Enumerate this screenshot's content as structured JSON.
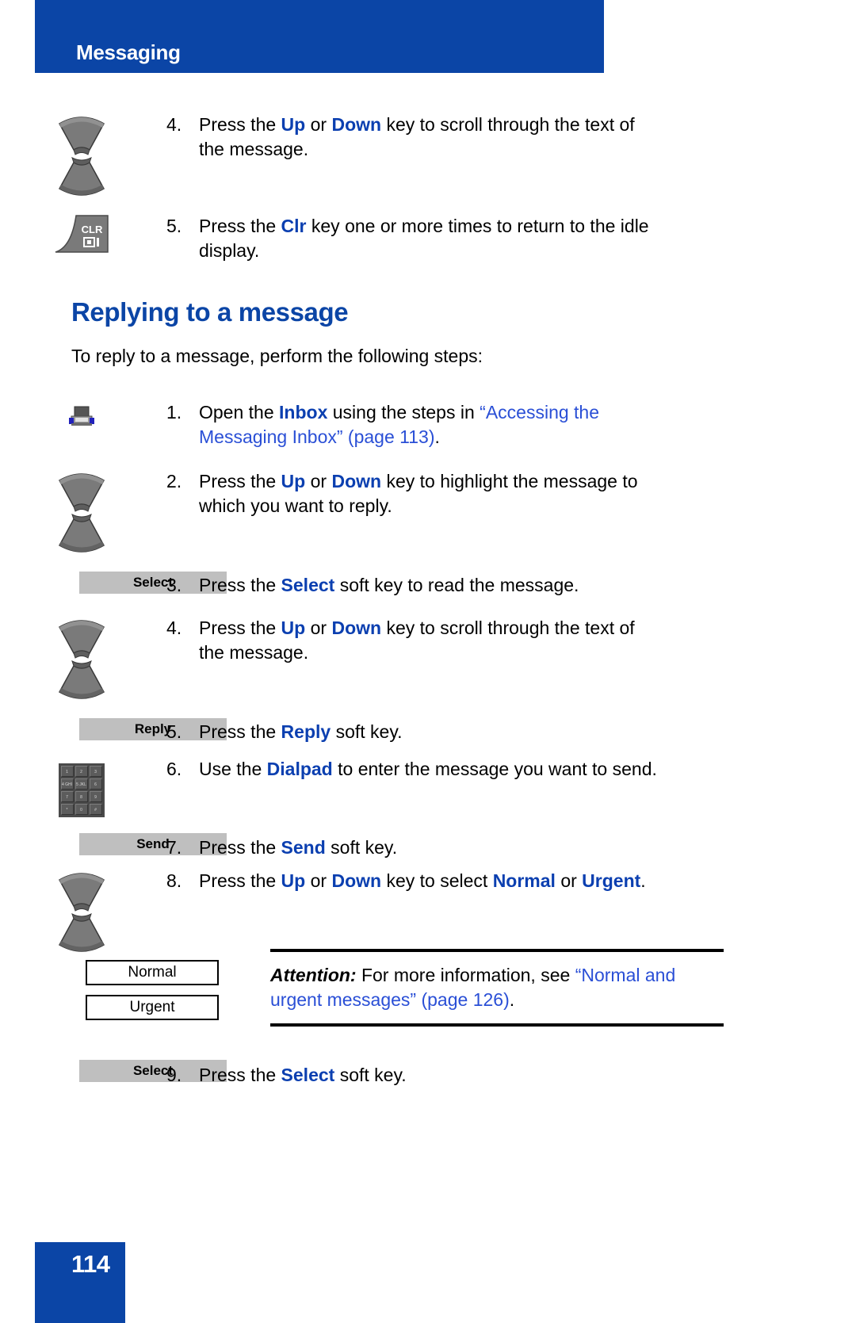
{
  "header": {
    "title": "Messaging",
    "bar_color": "#0b45a6"
  },
  "footer": {
    "page_number": "114",
    "box_color": "#0b45a6"
  },
  "colors": {
    "heading_blue": "#0b45a6",
    "bold_term_blue": "#0b3fb0",
    "link_blue": "#2a4fd6",
    "softkey_gray": "#bfbfbf",
    "key_gray": "#767676"
  },
  "top_steps": [
    {
      "number": "4.",
      "icon": "nav-up-down-key",
      "text_parts": [
        {
          "t": "Press the ",
          "style": "plain"
        },
        {
          "t": "Up",
          "style": "bold"
        },
        {
          "t": " or ",
          "style": "plain"
        },
        {
          "t": "Down",
          "style": "bold"
        },
        {
          "t": " key to scroll through the text of the message.",
          "style": "plain"
        }
      ]
    },
    {
      "number": "5.",
      "icon": "clr-key",
      "text_parts": [
        {
          "t": "Press the ",
          "style": "plain"
        },
        {
          "t": "Clr",
          "style": "bold"
        },
        {
          "t": " key one or more times to return to the idle display.",
          "style": "plain"
        }
      ]
    }
  ],
  "section": {
    "heading": "Replying to a message",
    "intro": "To reply to a message, perform the following steps:"
  },
  "steps": [
    {
      "number": "1.",
      "icon": "inbox-icon",
      "text_parts": [
        {
          "t": "Open the ",
          "style": "plain"
        },
        {
          "t": "Inbox",
          "style": "bold"
        },
        {
          "t": " using the steps in ",
          "style": "plain"
        },
        {
          "t": "“Accessing the Messaging Inbox” (page 113)",
          "style": "link"
        },
        {
          "t": ".",
          "style": "plain"
        }
      ]
    },
    {
      "number": "2.",
      "icon": "nav-up-down-key",
      "text_parts": [
        {
          "t": "Press the ",
          "style": "plain"
        },
        {
          "t": "Up",
          "style": "bold"
        },
        {
          "t": " or ",
          "style": "plain"
        },
        {
          "t": "Down",
          "style": "bold"
        },
        {
          "t": " key to highlight the message to which you want to reply.",
          "style": "plain"
        }
      ]
    },
    {
      "number": "3.",
      "icon": "softkey-select",
      "softkey_label": "Select",
      "text_parts": [
        {
          "t": "Press the ",
          "style": "plain"
        },
        {
          "t": "Select",
          "style": "bold"
        },
        {
          "t": " soft key to read the message.",
          "style": "plain"
        }
      ]
    },
    {
      "number": "4.",
      "icon": "nav-up-down-key",
      "text_parts": [
        {
          "t": "Press the ",
          "style": "plain"
        },
        {
          "t": "Up",
          "style": "bold"
        },
        {
          "t": " or ",
          "style": "plain"
        },
        {
          "t": "Down",
          "style": "bold"
        },
        {
          "t": " key to scroll through the text of the message.",
          "style": "plain"
        }
      ]
    },
    {
      "number": "5.",
      "icon": "softkey-reply",
      "softkey_label": "Reply",
      "text_parts": [
        {
          "t": "Press the ",
          "style": "plain"
        },
        {
          "t": "Reply",
          "style": "bold"
        },
        {
          "t": " soft key.",
          "style": "plain"
        }
      ]
    },
    {
      "number": "6.",
      "icon": "dialpad-icon",
      "text_parts": [
        {
          "t": "Use the ",
          "style": "plain"
        },
        {
          "t": "Dialpad",
          "style": "bold"
        },
        {
          "t": " to enter the message you want to send.",
          "style": "plain"
        }
      ]
    },
    {
      "number": "7.",
      "icon": "softkey-send",
      "softkey_label": "Send",
      "text_parts": [
        {
          "t": "Press the ",
          "style": "plain"
        },
        {
          "t": "Send",
          "style": "bold"
        },
        {
          "t": " soft key.",
          "style": "plain"
        }
      ]
    },
    {
      "number": "8.",
      "icon": "nav-up-down-key",
      "text_parts": [
        {
          "t": "Press the ",
          "style": "plain"
        },
        {
          "t": "Up",
          "style": "bold"
        },
        {
          "t": " or ",
          "style": "plain"
        },
        {
          "t": "Down",
          "style": "bold"
        },
        {
          "t": " key to select ",
          "style": "plain"
        },
        {
          "t": "Normal",
          "style": "bold"
        },
        {
          "t": " or ",
          "style": "plain"
        },
        {
          "t": "Urgent",
          "style": "bold"
        },
        {
          "t": ".",
          "style": "plain"
        }
      ]
    },
    {
      "number": "9.",
      "icon": "softkey-select",
      "softkey_label": "Select",
      "text_parts": [
        {
          "t": "Press the ",
          "style": "plain"
        },
        {
          "t": "Select",
          "style": "bold"
        },
        {
          "t": " soft key.",
          "style": "plain"
        }
      ]
    }
  ],
  "option_boxes": [
    {
      "label": "Normal"
    },
    {
      "label": "Urgent"
    }
  ],
  "attention_note": {
    "label": "Attention:",
    "lead": " For more information, see ",
    "link": "“Normal and urgent messages” (page 126)",
    "tail": "."
  },
  "dialpad_keys": [
    "1",
    "2 ABC",
    "3 DEF",
    "4 GHI",
    "5 JKL",
    "6 MNO",
    "7 PQRS",
    "8 TUV",
    "9 WXYZ",
    "*",
    "0",
    "#"
  ],
  "clr_key": {
    "label": "CLR",
    "glyph": "▣▏"
  },
  "labels": {
    "step4_text_line1": "Press the Up or Down key to scroll through the text",
    "step4_text_line2": "of the message."
  }
}
